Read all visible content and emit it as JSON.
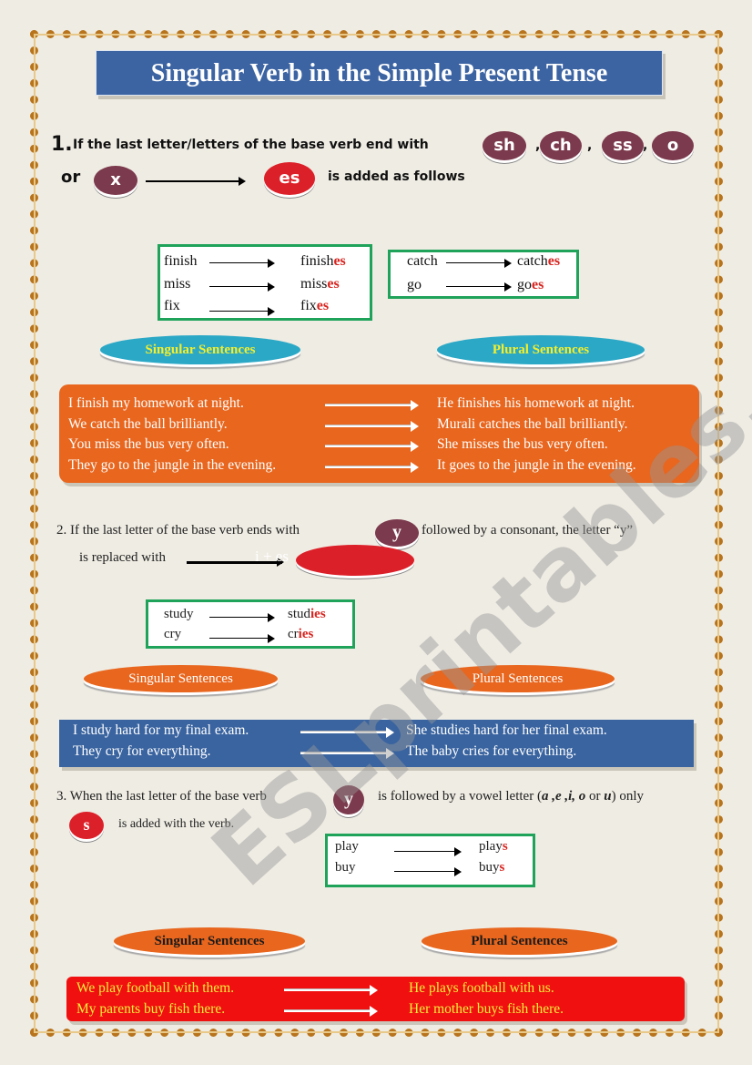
{
  "title": "Singular Verb in the Simple Present Tense",
  "section1": {
    "number": "1.",
    "text": "If the last letter/letters of the base verb end with",
    "endings": [
      "sh",
      "ch",
      "ss",
      "o",
      "x"
    ],
    "or": "or",
    "commas": [
      ",",
      ",",
      ","
    ],
    "suffix": "es",
    "tail": "is added as follows",
    "box1": [
      [
        "finish",
        "finish",
        "es"
      ],
      [
        "miss",
        "miss",
        "es"
      ],
      [
        "fix",
        "fix",
        "es"
      ]
    ],
    "box2": [
      [
        "catch",
        "catch",
        "es"
      ],
      [
        "go",
        "go",
        "es"
      ]
    ],
    "singular_label": "Singular Sentences",
    "plural_label": "Plural Sentences",
    "sentences": [
      [
        "I finish my homework at night.",
        "He finishes his homework at night."
      ],
      [
        "We catch the ball brilliantly.",
        "Murali catches the ball brilliantly."
      ],
      [
        "You miss the bus very often.",
        "She  misses the bus very often."
      ],
      [
        "They go to the jungle in the evening.",
        "It goes to the jungle in the evening."
      ]
    ]
  },
  "section2": {
    "line1": "2. If the last letter of the base verb ends with",
    "letter": "y",
    "line1b": "followed by a consonant,  the letter “y”",
    "line2": "is replaced with",
    "replacement": "i + es",
    "box": [
      [
        "study",
        "stud",
        "ies"
      ],
      [
        "cry",
        "cr",
        "ies"
      ]
    ],
    "singular_label": "Singular Sentences",
    "plural_label": "Plural Sentences",
    "sentences": [
      [
        "I study hard for my final exam.",
        "She studies hard for her final exam."
      ],
      [
        "They cry for everything.",
        "The  baby cries for everything."
      ]
    ]
  },
  "section3": {
    "line1": "3.  When the last letter  of the base verb",
    "letter": "y",
    "line1b": "is followed by a vowel letter (",
    "vowels": "a ,e ,i, o",
    "or": " or ",
    "u": "u",
    "close": ") only",
    "suffix": "s",
    "line2": "is added with the verb.",
    "box": [
      [
        "play",
        "play",
        "s"
      ],
      [
        "buy",
        "buy",
        "s"
      ]
    ],
    "singular_label": "Singular Sentences",
    "plural_label": "Plural Sentences",
    "sentences": [
      [
        "We play football with them.",
        "He plays football with us."
      ],
      [
        "My parents buy fish there.",
        "Her mother buys fish there."
      ]
    ]
  },
  "watermark": "ESLprintables.com",
  "colors": {
    "title_bg": "#3c64a3",
    "orange": "#e8661e",
    "blue": "#3a64a0",
    "red": "#f01010",
    "green_border": "#1fa35a",
    "teal": "#2ba8c6",
    "maroon": "#7b3a4d"
  }
}
